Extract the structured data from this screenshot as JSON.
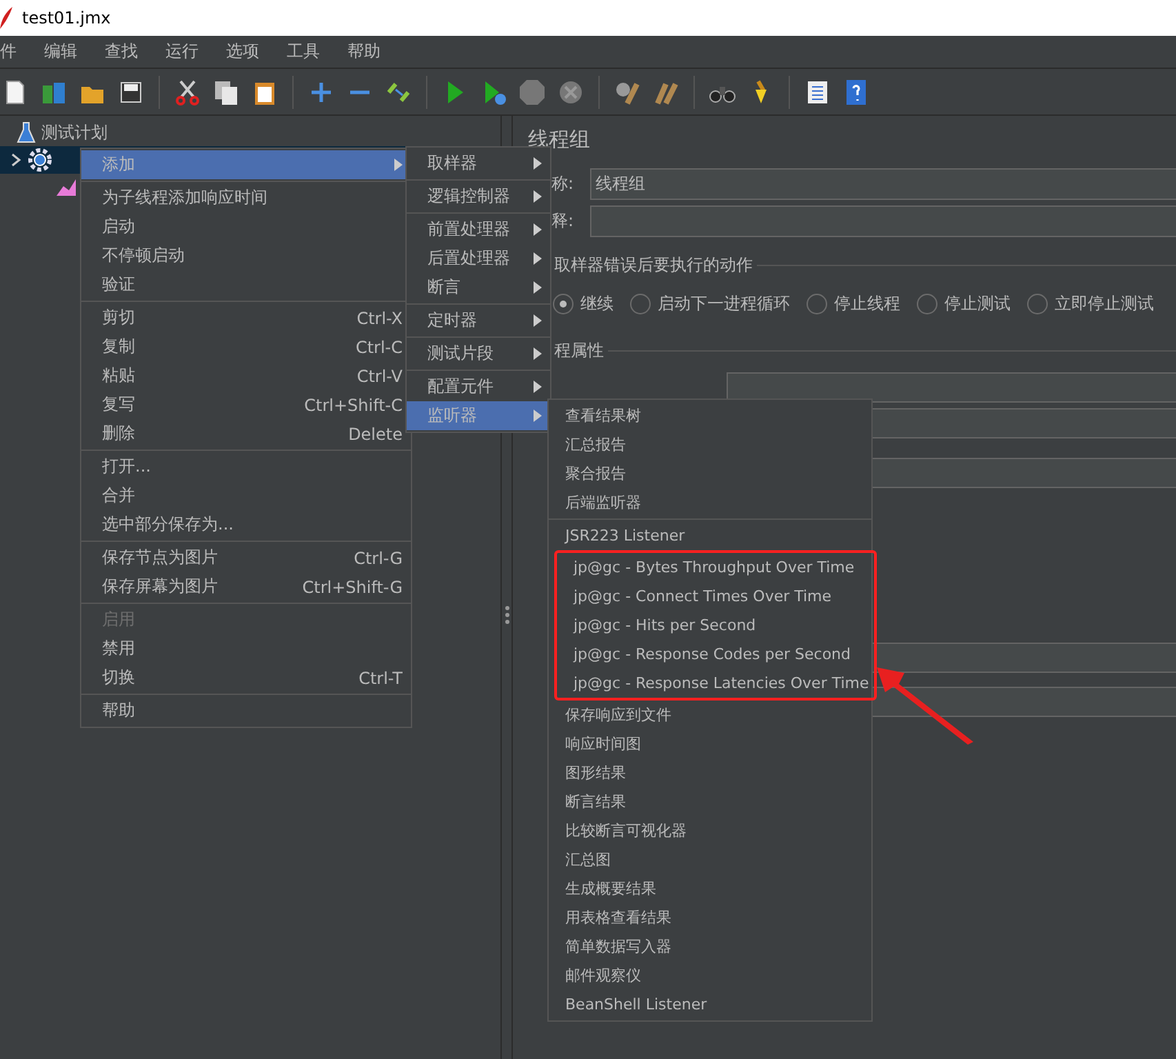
{
  "window": {
    "title": "test01.jmx"
  },
  "menu_bar": [
    "件",
    "编辑",
    "查找",
    "运行",
    "选项",
    "工具",
    "帮助"
  ],
  "tree": [
    {
      "label": "测试计划",
      "kind": "plan",
      "selected": false
    },
    {
      "kind": "thread",
      "selected": true
    },
    {
      "kind": "listener",
      "selected": false
    }
  ],
  "panel": {
    "title": "线程组",
    "fields": [
      {
        "label": "称:",
        "value": "线程组"
      },
      {
        "label": "释:"
      }
    ],
    "error_section": {
      "title": "取样器错误后要执行的动作",
      "options": [
        {
          "label": "继续",
          "selected": true
        },
        {
          "label": "启动下一进程循环",
          "selected": false
        },
        {
          "label": "停止线程",
          "selected": false
        },
        {
          "label": "停止测试",
          "selected": false
        },
        {
          "label": "立即停止测试",
          "selected": false
        }
      ]
    },
    "props_section": {
      "title": "程属性"
    }
  },
  "context_menu": {
    "groups": [
      {
        "items": [
          {
            "label": "添加",
            "submenu": true,
            "selected": true
          }
        ]
      },
      {
        "items": [
          {
            "label": "为子线程添加响应时间"
          },
          {
            "label": "启动"
          },
          {
            "label": "不停顿启动"
          },
          {
            "label": "验证"
          }
        ]
      },
      {
        "items": [
          {
            "label": "剪切",
            "shortcut": "Ctrl-X"
          },
          {
            "label": "复制",
            "shortcut": "Ctrl-C"
          },
          {
            "label": "粘贴",
            "shortcut": "Ctrl-V"
          },
          {
            "label": "复写",
            "shortcut": "Ctrl+Shift-C"
          },
          {
            "label": "删除",
            "shortcut": "Delete"
          }
        ]
      },
      {
        "items": [
          {
            "label": "打开..."
          },
          {
            "label": "合并"
          },
          {
            "label": "选中部分保存为..."
          }
        ]
      },
      {
        "items": [
          {
            "label": "保存节点为图片",
            "shortcut": "Ctrl-G"
          },
          {
            "label": "保存屏幕为图片",
            "shortcut": "Ctrl+Shift-G"
          }
        ]
      },
      {
        "items": [
          {
            "label": "启用",
            "disabled": true
          },
          {
            "label": "禁用"
          },
          {
            "label": "切换",
            "shortcut": "Ctrl-T"
          }
        ]
      },
      {
        "items": [
          {
            "label": "帮助"
          }
        ]
      }
    ]
  },
  "add_submenu": {
    "groups": [
      {
        "items": [
          {
            "label": "取样器",
            "submenu": true
          }
        ]
      },
      {
        "items": [
          {
            "label": "逻辑控制器",
            "submenu": true
          }
        ]
      },
      {
        "items": [
          {
            "label": "前置处理器",
            "submenu": true
          },
          {
            "label": "后置处理器",
            "submenu": true
          },
          {
            "label": "断言",
            "submenu": true
          }
        ]
      },
      {
        "items": [
          {
            "label": "定时器",
            "submenu": true
          }
        ]
      },
      {
        "items": [
          {
            "label": "测试片段",
            "submenu": true
          }
        ]
      },
      {
        "items": [
          {
            "label": "配置元件",
            "submenu": true
          },
          {
            "label": "监听器",
            "submenu": true,
            "selected": true
          }
        ]
      }
    ]
  },
  "listener_submenu": {
    "groups": [
      {
        "items": [
          {
            "label": "查看结果树"
          },
          {
            "label": "汇总报告"
          },
          {
            "label": "聚合报告"
          },
          {
            "label": "后端监听器"
          }
        ]
      },
      {
        "items": [
          {
            "label": "JSR223 Listener"
          },
          {
            "label": "jp@gc - Bytes Throughput Over Time",
            "annotated": true
          },
          {
            "label": "jp@gc - Connect Times Over Time",
            "annotated": true
          },
          {
            "label": "jp@gc - Hits per Second",
            "annotated": true
          },
          {
            "label": "jp@gc - Response Codes per Second",
            "annotated": true
          },
          {
            "label": "jp@gc - Response Latencies Over Time",
            "annotated": true
          },
          {
            "label": "保存响应到文件"
          },
          {
            "label": "响应时间图"
          },
          {
            "label": "图形结果"
          },
          {
            "label": "断言结果"
          },
          {
            "label": "比较断言可视化器"
          },
          {
            "label": "汇总图"
          },
          {
            "label": "生成概要结果"
          },
          {
            "label": "用表格查看结果"
          },
          {
            "label": "简单数据写入器"
          },
          {
            "label": "邮件观察仪"
          },
          {
            "label": "BeanShell Listener"
          }
        ]
      }
    ]
  }
}
